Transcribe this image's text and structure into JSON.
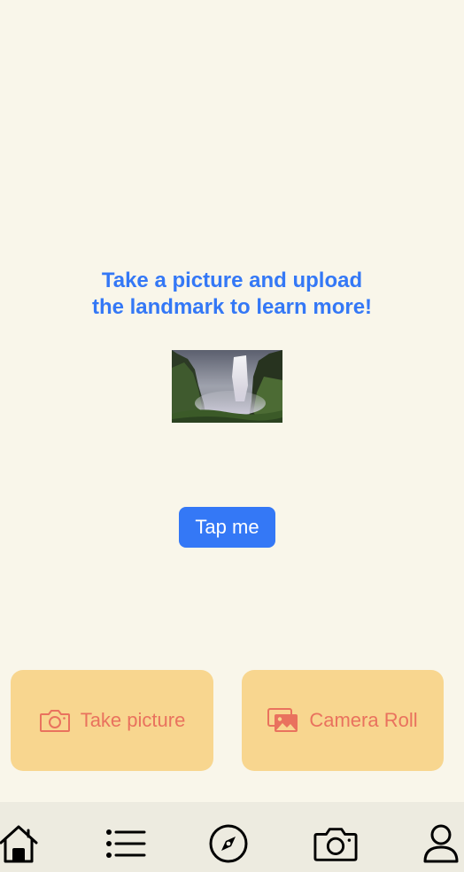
{
  "main": {
    "headline_line1": "Take a picture and upload",
    "headline_line2": "the landmark to learn more!",
    "image_subject": "waterfall landmark photo",
    "tap_button_label": "Tap me"
  },
  "actions": {
    "take_picture_label": "Take picture",
    "take_picture_icon": "camera-icon",
    "camera_roll_label": "Camera Roll",
    "camera_roll_icon": "photo-library-icon"
  },
  "tabbar": {
    "items": [
      {
        "icon": "home-icon",
        "selected": true
      },
      {
        "icon": "list-icon",
        "selected": false
      },
      {
        "icon": "compass-icon",
        "selected": false
      },
      {
        "icon": "camera-icon",
        "selected": false
      },
      {
        "icon": "person-icon",
        "selected": false
      }
    ]
  },
  "colors": {
    "background": "#f9f6ea",
    "accent_blue": "#3478f6",
    "card_background": "#f8d68f",
    "card_text": "#e9725e",
    "tabbar_background": "#edebe0"
  }
}
